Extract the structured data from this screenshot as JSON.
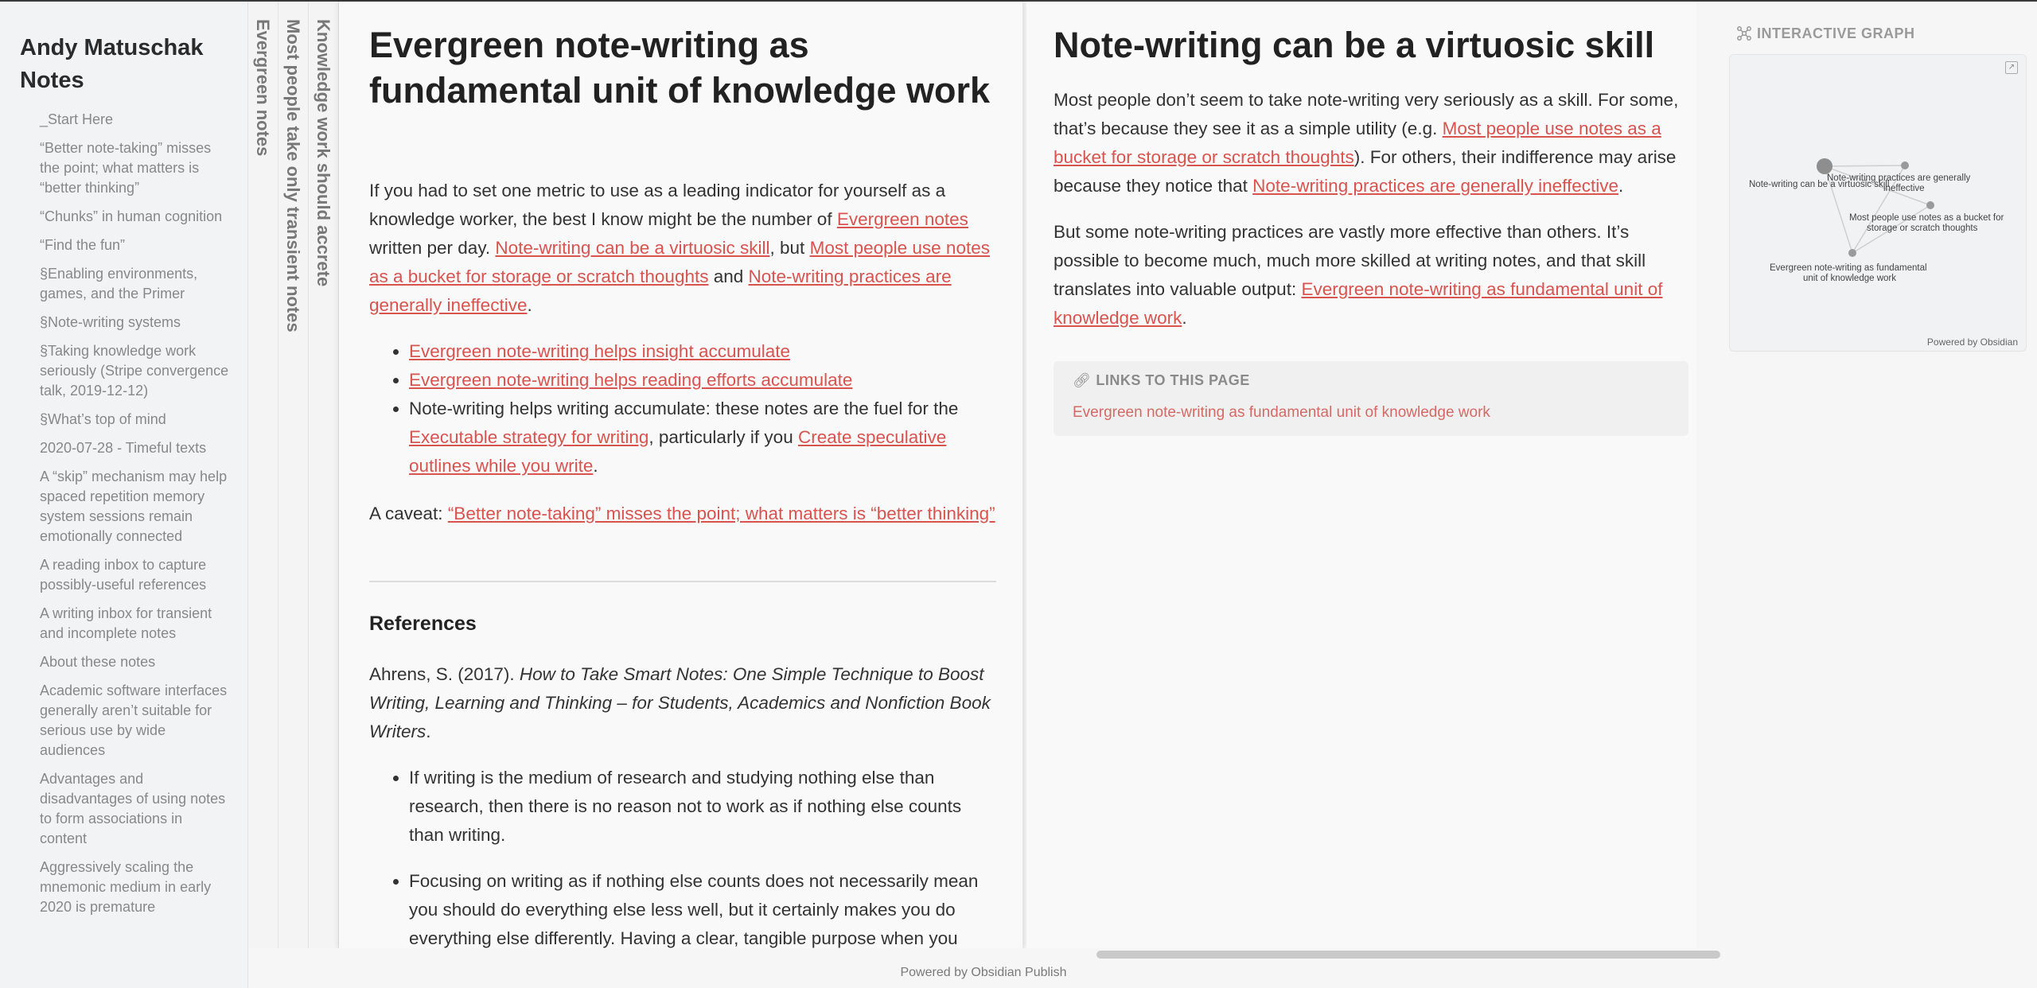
{
  "site": {
    "title": "Andy Matuschak Notes"
  },
  "sidebar": {
    "items": [
      "_Start Here",
      "“Better note-taking” misses the point; what matters is “better thinking”",
      "“Chunks” in human cognition",
      "“Find the fun”",
      "§Enabling environments, games, and the Primer",
      "§Note-writing systems",
      "§Taking knowledge work seriously (Stripe convergence talk, 2019-12-12)",
      "§What’s top of mind",
      "2020-07-28 - Timeful texts",
      "A “skip” mechanism may help spaced repetition memory system sessions remain emotionally connected",
      "A reading inbox to capture possibly-useful references",
      "A writing inbox for transient and incomplete notes",
      "About these notes",
      "Academic software interfaces generally aren’t suitable for serious use by wide audiences",
      "Advantages and disadvantages of using notes to form associations in content",
      "Aggressively scaling the mnemonic medium in early 2020 is premature"
    ]
  },
  "stack": {
    "spines": [
      "Evergreen notes",
      "Most people take only transient notes",
      "Knowledge work should accrete"
    ]
  },
  "pane1": {
    "title": "Evergreen note-writing as fundamental unit of knowledge work",
    "intro": {
      "t1": "If you had to set one metric to use as a leading indicator for yourself as a knowledge worker, the best I know might be the number of ",
      "l1": "Evergreen notes",
      "t2": " written per day. ",
      "l2": "Note-writing can be a virtuosic skill",
      "t3": ", but ",
      "l3": "Most people use notes as a bucket for storage or scratch thoughts",
      "t4": " and ",
      "l4": "Note-writing practices are generally ineffective",
      "t5": "."
    },
    "bullets": {
      "b1": "Evergreen note-writing helps insight accumulate",
      "b2": "Evergreen note-writing helps reading efforts accumulate",
      "b3_t1": "Note-writing helps writing accumulate: these notes are the fuel for the ",
      "b3_l1": "Executable strategy for writing",
      "b3_t2": ", particularly if you ",
      "b3_l2": "Create speculative outlines while you write",
      "b3_t3": "."
    },
    "caveat": {
      "label": "A caveat: ",
      "link": "“Better note-taking” misses the point; what matters is “better thinking”"
    },
    "references_heading": "References",
    "citation": {
      "author": "Ahrens, S. (2017). ",
      "work": "How to Take Smart Notes: One Simple Technique to Boost Writing, Learning and Thinking – for Students, Academics and Nonfiction Book Writers",
      "end": "."
    },
    "quotes": [
      "If writing is the medium of research and studying nothing else than research, then there is no reason not to work as if nothing else counts than writing.",
      "Focusing on writing as if nothing else counts does not necessarily mean you should do everything else less well, but it certainly makes you do everything else differently. Having a clear, tangible purpose when you"
    ]
  },
  "pane2": {
    "title": "Note-writing can be a virtuosic skill",
    "para1": {
      "t1": "Most people don’t seem to take note-writing very seriously as a skill. For some, that’s because they see it as a simple utility (e.g. ",
      "l1": "Most people use notes as a bucket for storage or scratch thoughts",
      "t2": "). For others, their indifference may arise because they notice that ",
      "l2": "Note-writing practices are generally ineffective",
      "t3": "."
    },
    "para2": {
      "t1": "But some note-writing practices are vastly more effective than others. It’s possible to become much, much more skilled at writing notes, and that skill translates into valuable output: ",
      "l1": "Evergreen note-writing as fundamental unit of knowledge work",
      "t2": "."
    },
    "backlinks": {
      "header": "LINKS TO THIS PAGE",
      "items": [
        "Evergreen note-writing as fundamental unit of knowledge work"
      ]
    }
  },
  "graph": {
    "header": "INTERACTIVE GRAPH",
    "powered": "Powered by Obsidian",
    "nodes": [
      {
        "label": "Note-writing can be a virtuosic skill",
        "current": true
      },
      {
        "label": "Note-writing practices are generally ineffective"
      },
      {
        "label": "Most people use notes as a bucket for storage or scratch thoughts"
      },
      {
        "label": "Evergreen note-writing as fundamental unit of knowledge work"
      }
    ]
  },
  "footer": {
    "text": "Powered by Obsidian Publish"
  },
  "colors": {
    "link": "#d9534f",
    "accent_text": "#2e2e2e"
  }
}
